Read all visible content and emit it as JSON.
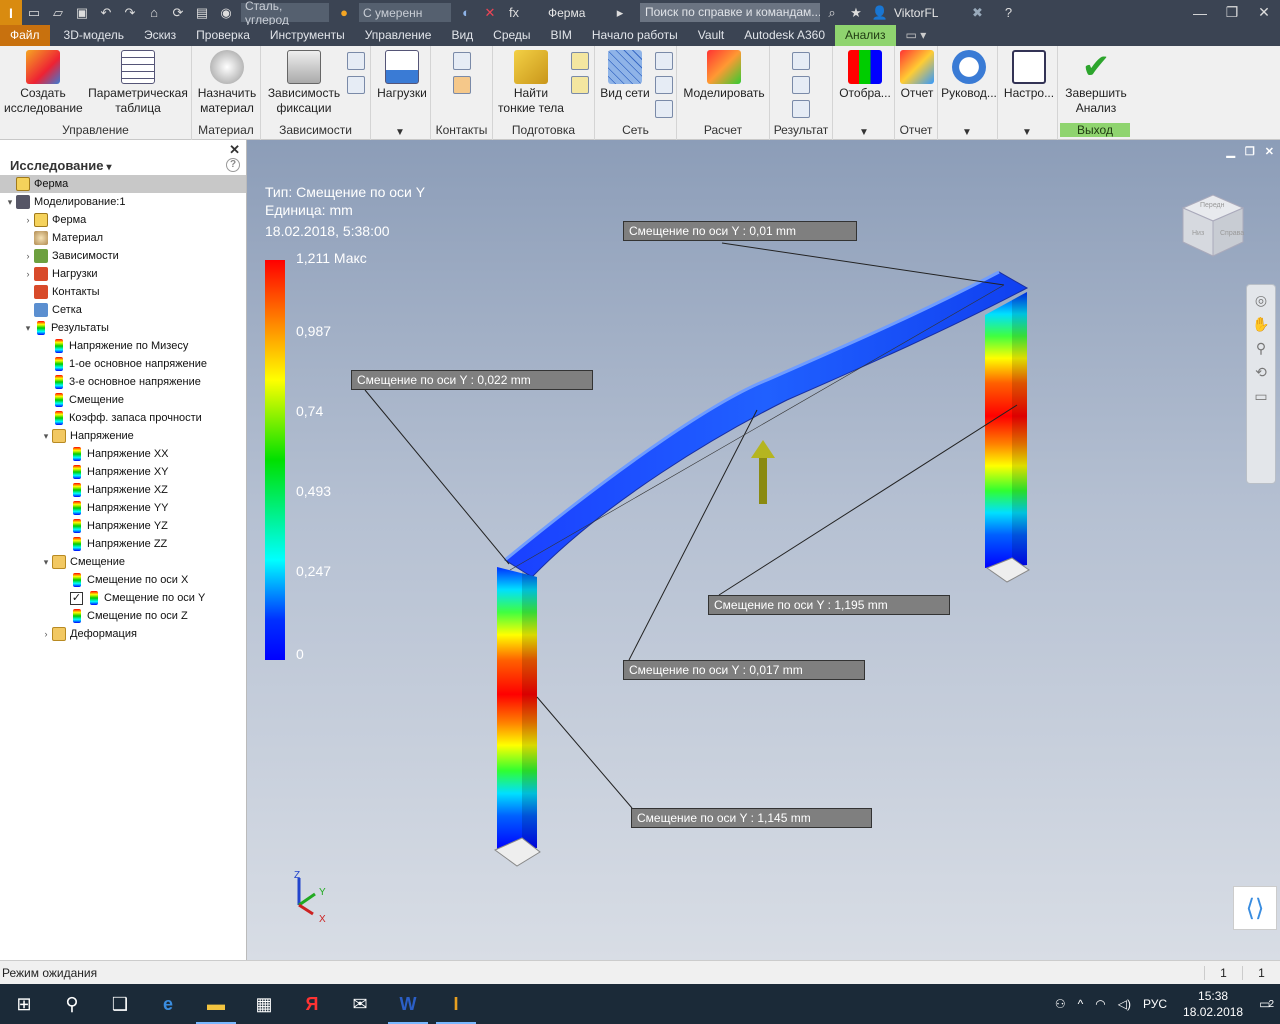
{
  "titlebar": {
    "logo": "I",
    "material": "Сталь, углерод",
    "appearance": "С умеренн",
    "fx": "fx",
    "document": "Ферма",
    "search_placeholder": "Поиск по справке и командам...",
    "user": "ViktorFL"
  },
  "menu": {
    "file": "Файл",
    "items": [
      "3D-модель",
      "Эскиз",
      "Проверка",
      "Инструменты",
      "Управление",
      "Вид",
      "Среды",
      "BIM",
      "Начало работы",
      "Vault",
      "Autodesk A360"
    ],
    "active": "Анализ"
  },
  "ribbon": {
    "groups": [
      {
        "label": "Управление",
        "buttons": [
          "Создать\nисследование",
          "Параметрическая\nтаблица"
        ]
      },
      {
        "label": "Материал",
        "buttons": [
          "Назначить\nматериал"
        ]
      },
      {
        "label": "Зависимости",
        "buttons": [
          "Зависимость\nфиксации"
        ]
      },
      {
        "label": "",
        "buttons": [
          "Нагрузки"
        ]
      },
      {
        "label": "Контакты",
        "buttons": []
      },
      {
        "label": "Подготовка",
        "buttons": [
          "Найти\nтонкие тела"
        ]
      },
      {
        "label": "Сеть",
        "buttons": [
          "Вид сети"
        ]
      },
      {
        "label": "Расчет",
        "buttons": [
          "Моделировать"
        ]
      },
      {
        "label": "Результат",
        "buttons": []
      },
      {
        "label": "",
        "buttons": [
          "Отобра..."
        ]
      },
      {
        "label": "Отчет",
        "buttons": [
          "Отчет"
        ]
      },
      {
        "label": "",
        "buttons": [
          "Руковод..."
        ]
      },
      {
        "label": "",
        "buttons": [
          "Настро..."
        ]
      },
      {
        "label": "Выход",
        "buttons": [
          "Завершить\nАнализ"
        ]
      }
    ]
  },
  "browser": {
    "title": "Исследование",
    "tree": [
      {
        "label": "Ферма",
        "icon": "part",
        "level": 0,
        "selected": true
      },
      {
        "label": "Моделирование:1",
        "icon": "sim",
        "level": 0,
        "exp": "v"
      },
      {
        "label": "Ферма",
        "icon": "part",
        "level": 1,
        "exp": ">"
      },
      {
        "label": "Материал",
        "icon": "mat",
        "level": 1
      },
      {
        "label": "Зависимости",
        "icon": "con",
        "level": 1,
        "exp": ">"
      },
      {
        "label": "Нагрузки",
        "icon": "load",
        "level": 1,
        "exp": ">"
      },
      {
        "label": "Контакты",
        "icon": "load",
        "level": 1
      },
      {
        "label": "Сетка",
        "icon": "mesh",
        "level": 1
      },
      {
        "label": "Результаты",
        "icon": "res",
        "level": 1,
        "exp": "v"
      },
      {
        "label": "Напряжение по Мизесу",
        "icon": "res",
        "level": 2
      },
      {
        "label": "1-ое основное напряжение",
        "icon": "res",
        "level": 2
      },
      {
        "label": "3-е основное напряжение",
        "icon": "res",
        "level": 2
      },
      {
        "label": "Смещение",
        "icon": "res",
        "level": 2
      },
      {
        "label": "Коэфф. запаса прочности",
        "icon": "res",
        "level": 2
      },
      {
        "label": "Напряжение",
        "icon": "folder",
        "level": 2,
        "exp": "v"
      },
      {
        "label": "Напряжение XX",
        "icon": "res",
        "level": 3
      },
      {
        "label": "Напряжение XY",
        "icon": "res",
        "level": 3
      },
      {
        "label": "Напряжение XZ",
        "icon": "res",
        "level": 3
      },
      {
        "label": "Напряжение YY",
        "icon": "res",
        "level": 3
      },
      {
        "label": "Напряжение YZ",
        "icon": "res",
        "level": 3
      },
      {
        "label": "Напряжение ZZ",
        "icon": "res",
        "level": 3
      },
      {
        "label": "Смещение",
        "icon": "folder",
        "level": 2,
        "exp": "v"
      },
      {
        "label": "Смещение по оси X",
        "icon": "res",
        "level": 3
      },
      {
        "label": "Смещение по оси Y",
        "icon": "res",
        "level": 3,
        "checked": true
      },
      {
        "label": "Смещение по оси Z",
        "icon": "res",
        "level": 3
      },
      {
        "label": "Деформация",
        "icon": "folder",
        "level": 2,
        "exp": ">"
      }
    ]
  },
  "viewport": {
    "type_line": "Тип: Смещение по оси Y",
    "unit_line": "Единица: mm",
    "date_line": "18.02.2018, 5:38:00",
    "legend": [
      "1,211 Макс",
      "0,987",
      "0,74",
      "0,493",
      "0,247",
      "0"
    ],
    "callouts": [
      "Смещение по оси Y : 0,01 mm",
      "Смещение по оси Y : 0,022 mm",
      "Смещение по оси Y : 1,195 mm",
      "Смещение по оси Y : 0,017 mm",
      "Смещение по оси Y : 1,145 mm"
    ],
    "cube_faces": [
      "Передн",
      "Справа",
      "Низ"
    ],
    "axes": [
      "Z",
      "Y",
      "X"
    ]
  },
  "status": {
    "text": "Режим ожидания",
    "c1": "1",
    "c2": "1"
  },
  "tray": {
    "lang": "РУС",
    "time": "15:38",
    "date": "18.02.2018",
    "notif": "2"
  }
}
